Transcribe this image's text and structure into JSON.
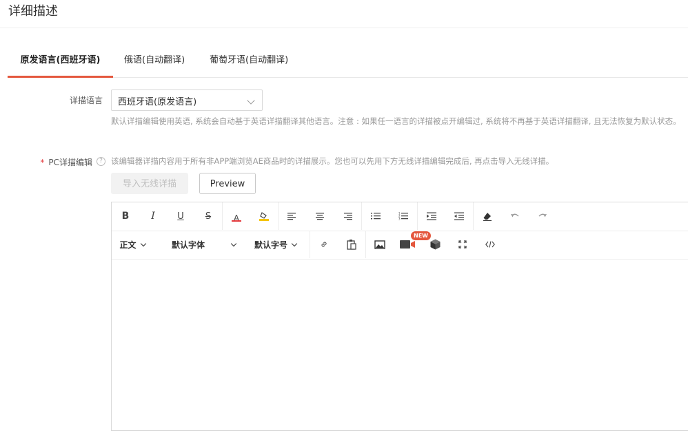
{
  "section_title": "详细描述",
  "tabs": [
    {
      "label": "原发语言(西班牙语)",
      "active": true
    },
    {
      "label": "俄语(自动翻译)",
      "active": false
    },
    {
      "label": "葡萄牙语(自动翻译)",
      "active": false
    }
  ],
  "language_field": {
    "label": "详描语言",
    "value": "西班牙语(原发语言)",
    "hint": "默认详描编辑使用英语, 系统会自动基于英语详描翻译其他语言。注意 : 如果任一语言的详描被点开编辑过, 系统将不再基于英语详描翻译, 且无法恢复为默认状态。"
  },
  "pc_field": {
    "required_mark": "*",
    "label": "PC详描编辑",
    "hint": "该编辑器详描内容用于所有非APP端浏览AE商品时的详描展示。您也可以先用下方无线详描编辑完成后, 再点击导入无线详描。",
    "import_button": "导入无线详描",
    "preview_button": "Preview"
  },
  "editor_toolbar": {
    "paragraph_style": "正文",
    "font_family": "默认字体",
    "font_size": "默认字号",
    "new_badge": "NEW",
    "bold": "B",
    "italic": "I",
    "underline": "U",
    "strikethrough": "S",
    "font_color_letter": "A",
    "font_color": "#e4393c",
    "highlight_color": "#f5c400"
  },
  "accent_color": "#e4573d"
}
